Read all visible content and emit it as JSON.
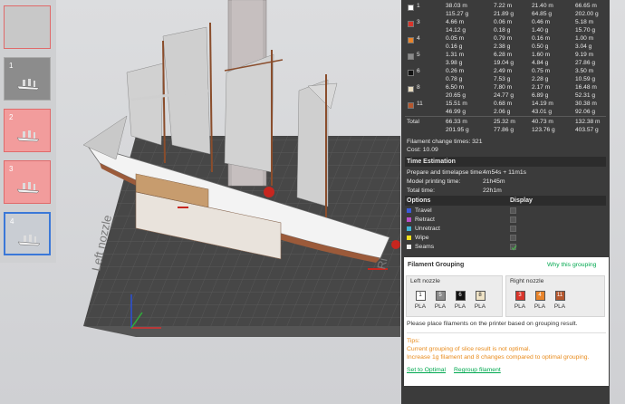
{
  "thumbnails": [
    {
      "num": "",
      "bg": "#c8c8c8",
      "border": "#e06a6a",
      "boat": false
    },
    {
      "num": "1",
      "bg": "#8c8c8c",
      "border": "#aaaaaa",
      "boat": true
    },
    {
      "num": "2",
      "bg": "#f29c9c",
      "border": "#e06a6a",
      "boat": true
    },
    {
      "num": "3",
      "bg": "#f29c9c",
      "border": "#e06a6a",
      "boat": true
    },
    {
      "num": "4",
      "bg": "#c9cdd3",
      "border": "#3b78d8",
      "boat": true
    }
  ],
  "plate": {
    "label": "Left nozzle",
    "label2": "Ri"
  },
  "filaments": [
    {
      "id": "1",
      "color": "#ffffff",
      "a": "38.03 m",
      "b": "115.27 g",
      "c": "7.22 m",
      "d": "21.89 g",
      "e": "21.40 m",
      "f": "64.85 g",
      "g": "66.65 m",
      "h": "202.00 g"
    },
    {
      "id": "3",
      "color": "#d9352b",
      "a": "4.66 m",
      "b": "14.12 g",
      "c": "0.06 m",
      "d": "0.18 g",
      "e": "0.46 m",
      "f": "1.40 g",
      "g": "5.18 m",
      "h": "15.70 g"
    },
    {
      "id": "4",
      "color": "#e8842b",
      "a": "0.05 m",
      "b": "0.16 g",
      "c": "0.79 m",
      "d": "2.38 g",
      "e": "0.16 m",
      "f": "0.50 g",
      "g": "1.00 m",
      "h": "3.04 g"
    },
    {
      "id": "5",
      "color": "#8a8a8a",
      "a": "1.31 m",
      "b": "3.98 g",
      "c": "6.28 m",
      "d": "19.04 g",
      "e": "1.60 m",
      "f": "4.84 g",
      "g": "9.19 m",
      "h": "27.86 g"
    },
    {
      "id": "6",
      "color": "#111111",
      "a": "0.26 m",
      "b": "0.78 g",
      "c": "2.49 m",
      "d": "7.53 g",
      "e": "0.75 m",
      "f": "2.28 g",
      "g": "3.50 m",
      "h": "10.59 g"
    },
    {
      "id": "8",
      "color": "#e8dcc0",
      "a": "6.50 m",
      "b": "20.65 g",
      "c": "7.80 m",
      "d": "24.77 g",
      "e": "2.17 m",
      "f": "6.89 g",
      "g": "16.48 m",
      "h": "52.31 g"
    },
    {
      "id": "11",
      "color": "#b5572e",
      "a": "15.51 m",
      "b": "46.99 g",
      "c": "0.68 m",
      "d": "2.06 g",
      "e": "14.19 m",
      "f": "43.01 g",
      "g": "30.38 m",
      "h": "92.06 g"
    }
  ],
  "total": {
    "label": "Total",
    "a": "66.33 m",
    "b": "201.95 g",
    "c": "25.32 m",
    "d": "77.86 g",
    "e": "40.73 m",
    "f": "123.76 g",
    "g": "132.38 m",
    "h": "403.57 g"
  },
  "filament_change": "Filament change times:  321",
  "cost": "Cost:  10.09",
  "time": {
    "header": "Time Estimation",
    "prep_label": "Prepare and timelapse time:",
    "prep_value": "4m54s + 11m1s",
    "model_label": "Model printing time:",
    "model_value": "21h45m",
    "total_label": "Total time:",
    "total_value": "22h1m"
  },
  "options": {
    "header": "Options",
    "display": "Display",
    "items": [
      {
        "label": "Travel",
        "color": "#3a5bd9",
        "checked": false
      },
      {
        "label": "Retract",
        "color": "#b94fc8",
        "checked": false
      },
      {
        "label": "Unretract",
        "color": "#3fb6d8",
        "checked": false
      },
      {
        "label": "Wipe",
        "color": "#f2e01e",
        "checked": false
      },
      {
        "label": "Seams",
        "color": "#eeeeee",
        "checked": true
      }
    ]
  },
  "grouping": {
    "title": "Filament Grouping",
    "why": "Why this grouping",
    "left_title": "Left nozzle",
    "right_title": "Right nozzle",
    "left": [
      {
        "id": "1",
        "color": "#ffffff",
        "text": "#222",
        "type": "PLA"
      },
      {
        "id": "5",
        "color": "#8a8a8a",
        "text": "#fff",
        "type": "PLA"
      },
      {
        "id": "6",
        "color": "#111111",
        "text": "#fff",
        "type": "PLA"
      },
      {
        "id": "8",
        "color": "#efe3c6",
        "text": "#222",
        "type": "PLA"
      }
    ],
    "right": [
      {
        "id": "3",
        "color": "#d9352b",
        "text": "#fff",
        "type": "PLA"
      },
      {
        "id": "4",
        "color": "#e8842b",
        "text": "#fff",
        "type": "PLA"
      },
      {
        "id": "11",
        "color": "#b5572e",
        "text": "#fff",
        "type": "PLA"
      }
    ],
    "note": "Please place filaments on the printer based on grouping result.",
    "tips_label": "Tips:",
    "tip1": "Current grouping of slice result is not optimal.",
    "tip2": "Increase 1g filament and 8 changes compared to optimal grouping.",
    "set_optimal": "Set to Optimal",
    "regroup": "Regroup filament"
  }
}
